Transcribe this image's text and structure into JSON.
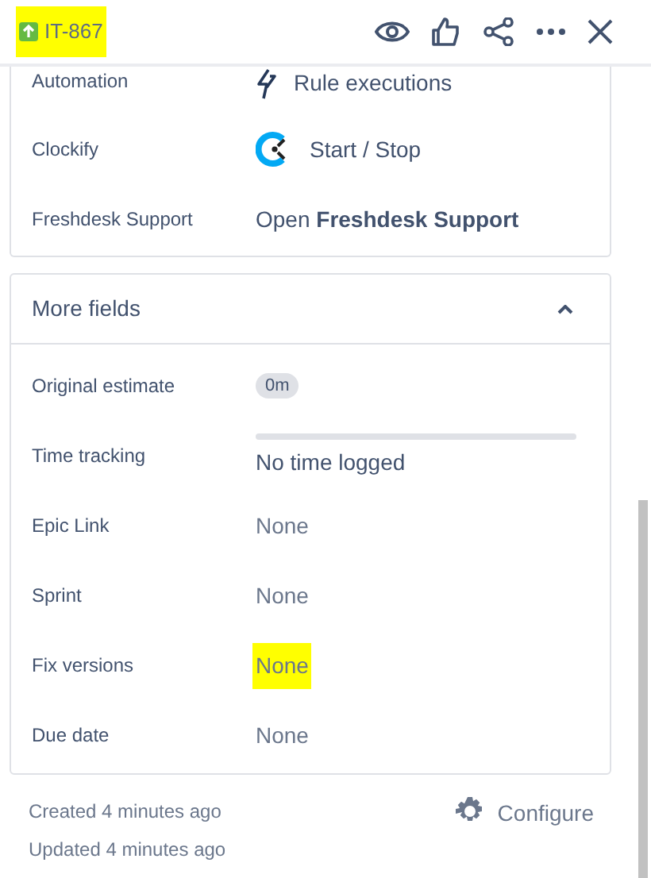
{
  "header": {
    "issue_key": "IT-867",
    "highlighted": true
  },
  "apps": [
    {
      "label": "Automation",
      "kind": "automation",
      "value": "Rule executions"
    },
    {
      "label": "Clockify",
      "kind": "clockify",
      "value": "Start / Stop"
    },
    {
      "label": "Freshdesk Support",
      "kind": "link",
      "value": "Open **Freshdesk Support**"
    }
  ],
  "more_fields": {
    "title": "More fields",
    "expanded": true,
    "fields": [
      {
        "label": "Original estimate",
        "kind": "pill",
        "value": "0m",
        "highlighted": false
      },
      {
        "label": "Time tracking",
        "kind": "tracking",
        "value": "No time logged",
        "highlighted": false
      },
      {
        "label": "Epic Link",
        "kind": "text",
        "value": "None",
        "highlighted": false
      },
      {
        "label": "Sprint",
        "kind": "text",
        "value": "None",
        "highlighted": false
      },
      {
        "label": "Fix versions",
        "kind": "text",
        "value": "None",
        "highlighted": true
      },
      {
        "label": "Due date",
        "kind": "text",
        "value": "None",
        "highlighted": false
      }
    ]
  },
  "footer": {
    "created": "Created 4 minutes ago",
    "updated": "Updated 4 minutes ago",
    "configure": "Configure"
  }
}
